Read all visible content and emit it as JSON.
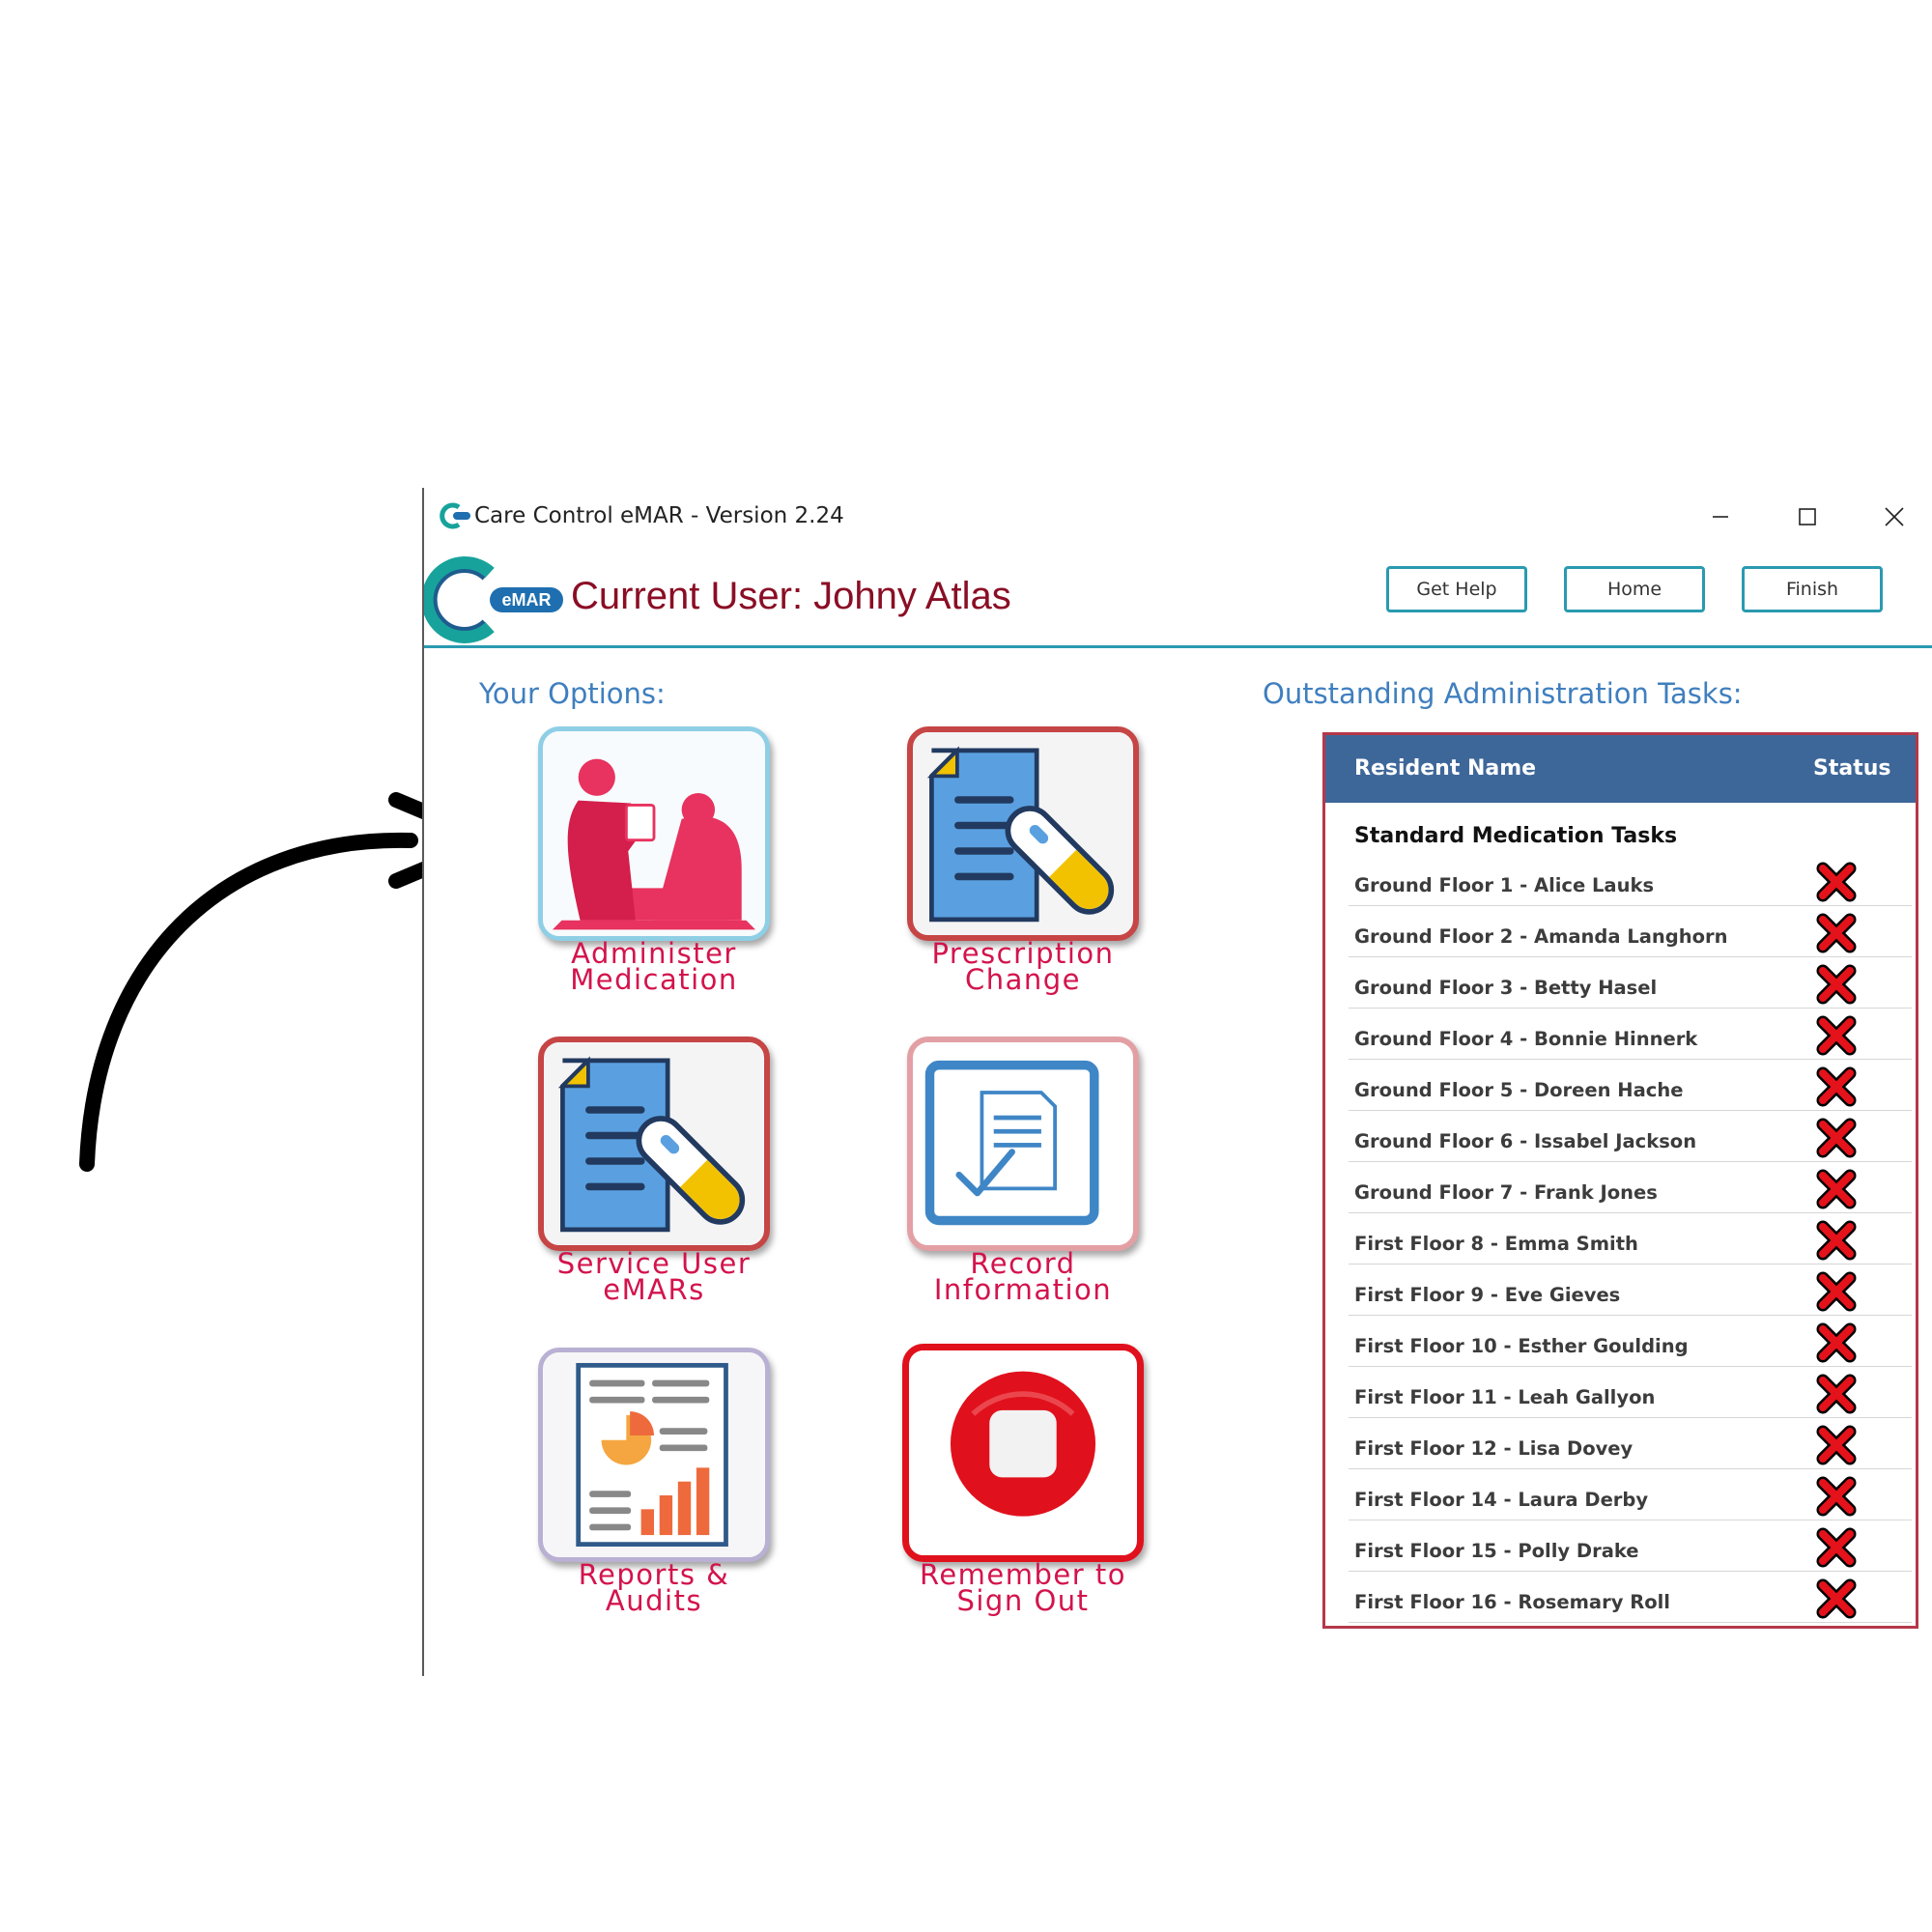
{
  "window": {
    "title": "Care Control eMAR - Version 2.24",
    "logo_badge": "eMAR"
  },
  "header": {
    "current_user": "Current User: Johny Atlas",
    "buttons": {
      "help": "Get Help",
      "home": "Home",
      "finish": "Finish"
    }
  },
  "options": {
    "title": "Your Options:",
    "items": [
      {
        "line1": "Administer",
        "line2": "Medication",
        "icon": "nurse-patient-icon"
      },
      {
        "line1": "Prescription",
        "line2": "Change",
        "icon": "document-pill-icon"
      },
      {
        "line1": "Service User",
        "line2": "eMARs",
        "icon": "document-pill-icon"
      },
      {
        "line1": "Record",
        "line2": "Information",
        "icon": "document-check-icon"
      },
      {
        "line1": "Reports &",
        "line2": "Audits",
        "icon": "report-chart-icon"
      },
      {
        "line1": "Remember to",
        "line2": "Sign Out",
        "icon": "stop-icon"
      }
    ]
  },
  "tasks": {
    "title": "Outstanding Administration Tasks:",
    "columns": {
      "name": "Resident Name",
      "status": "Status"
    },
    "group": "Standard Medication Tasks",
    "status_icon": "red-x-icon",
    "rows": [
      "Ground Floor 1 - Alice Lauks",
      "Ground Floor 2 - Amanda Langhorn",
      "Ground Floor 3 - Betty Hasel",
      "Ground Floor 4 - Bonnie Hinnerk",
      "Ground Floor 5 - Doreen Hache",
      "Ground Floor 6 - Issabel Jackson",
      "Ground Floor 7 - Frank Jones",
      "First Floor 8 - Emma Smith",
      "First Floor 9 - Eve Gieves",
      "First Floor 10 - Esther Goulding",
      "First Floor 11 - Leah Gallyon",
      "First Floor 12 - Lisa Dovey",
      "First Floor 14 - Laura Derby",
      "First Floor 15 - Polly Drake",
      "First Floor 16 - Rosemary Roll"
    ]
  },
  "colors": {
    "accent": "#2a9ab0",
    "user_text": "#8a0e25",
    "option_label": "#d3134c",
    "section_title": "#3f7fbf",
    "table_header": "#3e6799",
    "table_border": "#b53849"
  }
}
